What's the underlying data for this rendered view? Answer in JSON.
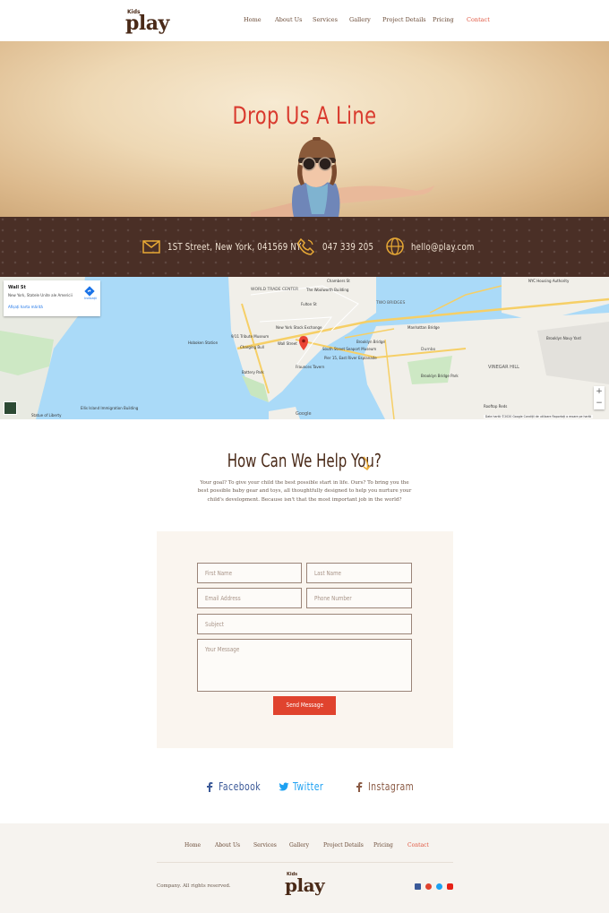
{
  "brand": {
    "small": "Kids",
    "name": "play"
  },
  "nav": {
    "items": [
      "Home",
      "About Us",
      "Services",
      "Gallery",
      "Project Details",
      "Pricing",
      "Contact"
    ],
    "active": "Contact"
  },
  "hero": {
    "title": "Drop Us A Line"
  },
  "contact": {
    "address": "1ST Street, New York, 041569 NY",
    "phone": "047 339 205",
    "email": "hello@play.com",
    "icons": [
      "mail-icon",
      "phone-icon",
      "globe-icon"
    ]
  },
  "map": {
    "place_title": "Wall St",
    "place_address": "New York, Statele Unite ale Americii",
    "larger_map_link": "Afișați harta mărită",
    "directions_label": "Indicații",
    "attribution": "Date hartă ©2020 Google   Condiții de utilizare   Raportați o eroare pe hartă",
    "google": "Google",
    "labels": [
      "WORLD TRADE CENTER",
      "TWO BRIDGES",
      "VINEGAR HILL",
      "Wall Street",
      "Brooklyn Bridge",
      "Manhattan Bridge",
      "New York Stock Exchange",
      "Fraunces Tavern",
      "South Street Seaport Museum",
      "Pier 15, East River Esplanade",
      "Battery Park",
      "Ellis Island Immigration Building",
      "Statue of Liberty",
      "Hoboken Station",
      "9/11 Tribute Museum",
      "Charging Bull",
      "The Woolworth Building",
      "Chambers St",
      "Fulton St",
      "NYC Housing Authority",
      "Brooklyn Navy Yard",
      "Dumbo",
      "Rooftop Reds",
      "Brooklyn Bridge Park"
    ]
  },
  "help": {
    "title": "How Can We Help You?",
    "text": "Your goal? To give your child the best possible start in life. Ours? To bring you the best possible baby gear and toys, all thoughtfully designed to help you nurture your child's development. Because isn't that the most important job in the world?"
  },
  "form": {
    "first_name": "First Name",
    "last_name": "Last Name",
    "email": "Email Address",
    "phone": "Phone Number",
    "subject": "Subject",
    "message": "Your Message",
    "submit": "Send Message"
  },
  "social": [
    {
      "label": "Facebook",
      "color": "#3b5998",
      "icon": "facebook-icon"
    },
    {
      "label": "Twitter",
      "color": "#1da1f2",
      "icon": "twitter-icon"
    },
    {
      "label": "Instagram",
      "color": "#8a5a44",
      "icon": "instagram-icon"
    }
  ],
  "footer": {
    "copyright": "Company. All rights reserved.",
    "icon_colors": [
      "#3b5998",
      "#e0432e",
      "#1da1f2",
      "#e62117"
    ]
  },
  "colors": {
    "accent": "#e0432e",
    "brown": "#4a2f26",
    "title_red": "#d93a2e"
  }
}
